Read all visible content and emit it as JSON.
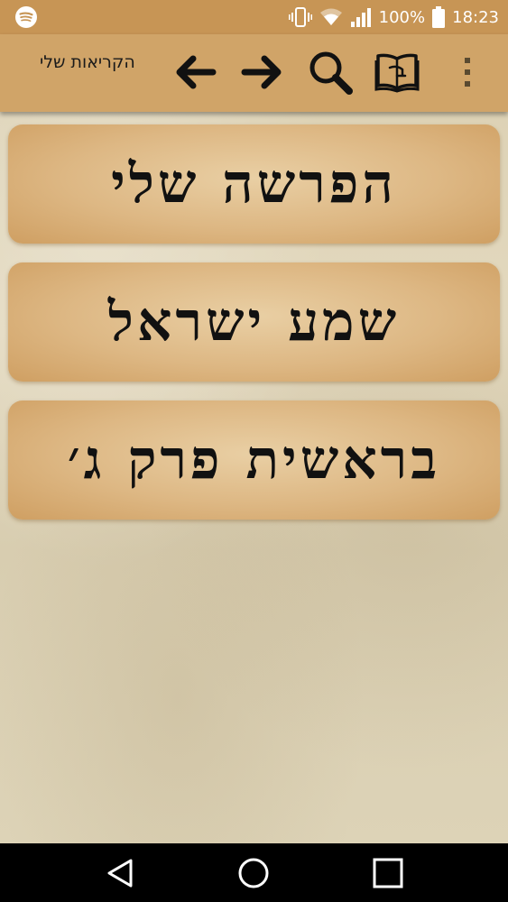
{
  "status_bar": {
    "left_icon": "spotify-icon",
    "icons": [
      "vibrate-icon",
      "wifi-icon",
      "signal-icon"
    ],
    "battery_percent": "100%",
    "battery_icon": "battery-full-icon",
    "time": "18:23"
  },
  "toolbar": {
    "title": "הקריאות שלי",
    "back_icon": "arrow-left-icon",
    "forward_icon": "arrow-right-icon",
    "search_icon": "search-icon",
    "book_icon": "book-icon",
    "menu_icon": "overflow-menu-icon"
  },
  "readings": [
    {
      "label": "הפרשה שלי"
    },
    {
      "label": "שמע ישראל"
    },
    {
      "label": "בראשית פרק ג׳"
    }
  ],
  "nav_bar": {
    "back_icon": "nav-back-icon",
    "home_icon": "nav-home-icon",
    "recents_icon": "nav-recents-icon"
  },
  "colors": {
    "toolbar": "#d0a468",
    "status_bar": "#c79555",
    "card": "#ddb783",
    "parchment": "#ddd2b5"
  }
}
